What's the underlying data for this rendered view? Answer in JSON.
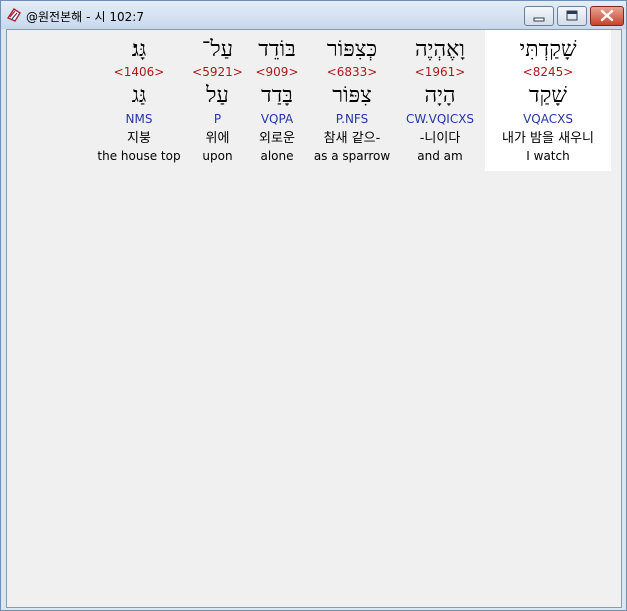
{
  "window": {
    "title_app": "@원전본해",
    "title_separator": "-",
    "title_ref": "시 102:7"
  },
  "colors": {
    "strong_number": "#b01818",
    "morph_code": "#2436a8",
    "selected_word_bg": "#ffffff",
    "client_bg": "#f0f0f0"
  },
  "words": [
    {
      "hebrew": "שָׁקַדְתִּי",
      "strong": "<8245>",
      "lemma": "שָׁקַד",
      "morph": "VQACXS",
      "korean": "내가 밤을 새우니",
      "english": "I watch"
    },
    {
      "hebrew": "וָאֶהְיֶה",
      "strong": "<1961>",
      "lemma": "הָיָה",
      "morph": "CW.VQICXS",
      "korean": "-니이다",
      "english": "and am"
    },
    {
      "hebrew": "כְּצִפּוֹר",
      "strong": "<6833>",
      "lemma": "צִפּוֹר",
      "morph": "P.NFS",
      "korean": "참새 같으-",
      "english": "as a sparrow"
    },
    {
      "hebrew": "בּוֹדֵד",
      "strong": "<909>",
      "lemma": "בָּדַד",
      "morph": "VQPA",
      "korean": "외로운",
      "english": "alone"
    },
    {
      "hebrew": "עַל־",
      "strong": "<5921>",
      "lemma": "עַל",
      "morph": "P",
      "korean": "위에",
      "english": "upon"
    },
    {
      "hebrew": "גָּג׃",
      "strong": "<1406>",
      "lemma": "גַּג",
      "morph": "NMS",
      "korean": "지붕",
      "english": "the house top"
    }
  ]
}
